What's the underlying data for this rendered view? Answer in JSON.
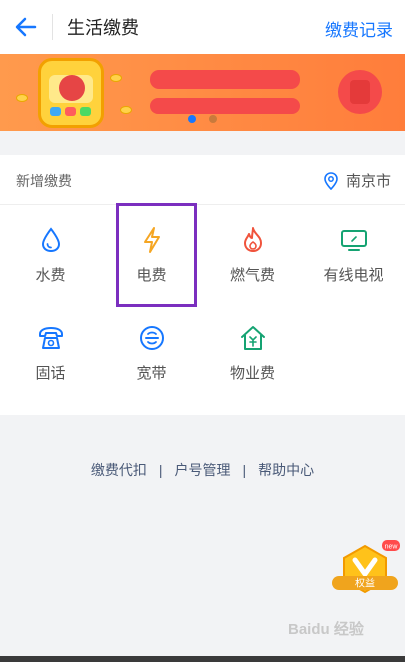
{
  "header": {
    "title": "生活缴费",
    "records_label": "缴费记录"
  },
  "section": {
    "label": "新增缴费",
    "city": "南京市"
  },
  "services": [
    {
      "label": "水费",
      "icon": "water-drop-icon",
      "color": "#1677ff"
    },
    {
      "label": "电费",
      "icon": "lightning-icon",
      "color": "#f5a623"
    },
    {
      "label": "燃气费",
      "icon": "flame-icon",
      "color": "#f0533c"
    },
    {
      "label": "有线电视",
      "icon": "tv-icon",
      "color": "#15a372"
    },
    {
      "label": "固话",
      "icon": "telephone-icon",
      "color": "#1677ff"
    },
    {
      "label": "宽带",
      "icon": "broadband-icon",
      "color": "#1677ff"
    },
    {
      "label": "物业费",
      "icon": "property-house-icon",
      "color": "#15a372"
    }
  ],
  "links": {
    "auto_pay": "缴费代扣",
    "account_manage": "户号管理",
    "help": "帮助中心",
    "separator": "|"
  },
  "badge": {
    "new_label": "new",
    "text": "权益"
  },
  "watermark": "Baidu 经验",
  "colors": {
    "accent": "#1677ff",
    "banner": "#ff8a42",
    "highlight": "#7b2fbf"
  }
}
